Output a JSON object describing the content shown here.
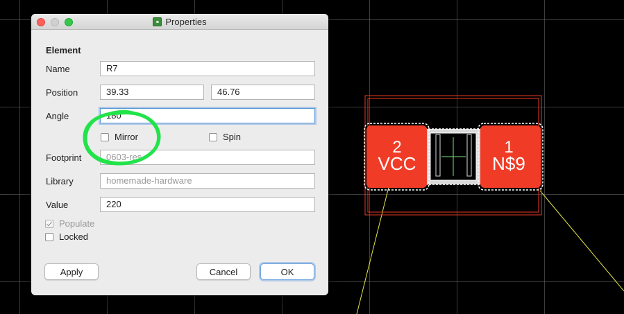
{
  "window": {
    "title": "Properties",
    "app_icon": "eagle-app-icon"
  },
  "dialog": {
    "section_title": "Element",
    "name": {
      "label": "Name",
      "value": "R7"
    },
    "position": {
      "label": "Position",
      "x": "39.33",
      "y": "46.76"
    },
    "angle": {
      "label": "Angle",
      "value": "180"
    },
    "mirror": {
      "label": "Mirror",
      "checked": false
    },
    "spin": {
      "label": "Spin",
      "checked": false
    },
    "footprint": {
      "label": "Footprint",
      "value": "0603-res"
    },
    "library": {
      "label": "Library",
      "value": "homemade-hardware"
    },
    "value": {
      "label": "Value",
      "value": "220"
    },
    "populate": {
      "label": "Populate",
      "checked": true,
      "enabled": false
    },
    "locked": {
      "label": "Locked",
      "checked": false
    },
    "buttons": {
      "apply": "Apply",
      "cancel": "Cancel",
      "ok": "OK"
    }
  },
  "board": {
    "pad_left": {
      "number": "2",
      "net": "VCC"
    },
    "pad_right": {
      "number": "1",
      "net": "N$9"
    },
    "colors": {
      "background": "#000000",
      "grid": "#6e6e6e",
      "pad": "#f03c26",
      "outline": "#e83a26",
      "airwire": "#e6e64a",
      "body": "#d9d9d9",
      "center_mark": "#7ee07e"
    }
  },
  "annotation": {
    "color": "#22e34a",
    "shape": "hand-drawn-circle"
  }
}
